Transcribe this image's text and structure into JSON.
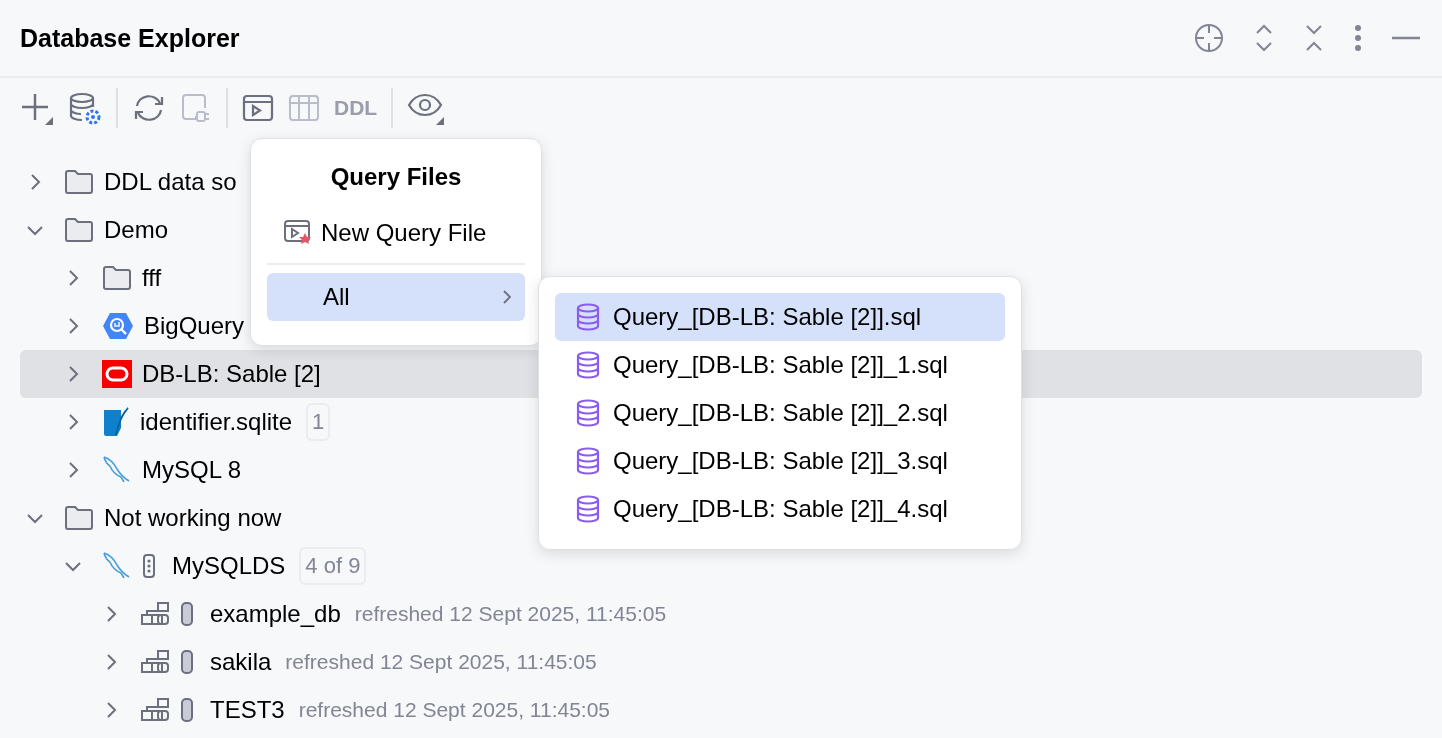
{
  "header": {
    "title": "Database Explorer"
  },
  "toolbar": [
    {
      "kind": "add",
      "disabled": false
    },
    {
      "kind": "db-settings",
      "disabled": false
    },
    {
      "kind": "sep"
    },
    {
      "kind": "refresh",
      "disabled": false
    },
    {
      "kind": "plug",
      "disabled": true
    },
    {
      "kind": "sep"
    },
    {
      "kind": "console",
      "disabled": false
    },
    {
      "kind": "table",
      "disabled": true
    },
    {
      "kind": "text",
      "label": "DDL",
      "disabled": true
    },
    {
      "kind": "sep"
    },
    {
      "kind": "eye",
      "disabled": false
    }
  ],
  "tree": [
    {
      "kind": "folder",
      "label": "DDL data so",
      "expanded": false,
      "selected": false
    },
    {
      "kind": "folder",
      "label": "Demo",
      "expanded": true,
      "selected": false,
      "children": [
        {
          "kind": "folder",
          "label": "fff",
          "expanded": false,
          "selected": false
        },
        {
          "kind": "bigquery",
          "label": "BigQuery",
          "expanded": false,
          "selected": false
        },
        {
          "kind": "oracle",
          "label": "DB-LB: Sable [2]",
          "expanded": false,
          "selected": true
        },
        {
          "kind": "sqlite",
          "label": "identifier.sqlite",
          "badge": "1",
          "expanded": false,
          "selected": false
        },
        {
          "kind": "mysql",
          "label": "MySQL 8",
          "expanded": false,
          "selected": false
        }
      ]
    },
    {
      "kind": "folder",
      "label": "Not working now",
      "expanded": true,
      "selected": false,
      "children": [
        {
          "kind": "mysql",
          "label": "MySQLDS",
          "badge": "4 of 9",
          "server": true,
          "expanded": true,
          "selected": false,
          "children": [
            {
              "kind": "schema",
              "label": "example_db",
              "detail": "refreshed 12 Sept 2025, 11:45:05",
              "expanded": false,
              "selected": false
            },
            {
              "kind": "schema",
              "label": "sakila",
              "detail": "refreshed 12 Sept 2025, 11:45:05",
              "expanded": false,
              "selected": false
            },
            {
              "kind": "schema",
              "label": "TEST3",
              "detail": "refreshed 12 Sept 2025, 11:45:05",
              "expanded": false,
              "selected": false
            }
          ]
        }
      ]
    }
  ],
  "query_menu": {
    "title": "Query Files",
    "items": [
      {
        "kind": "new",
        "label": "New Query File",
        "selected": false
      },
      {
        "kind": "submenu",
        "label": "All",
        "selected": true
      }
    ]
  },
  "all_submenu": {
    "items": [
      {
        "label": "Query_[DB-LB: Sable [2]].sql",
        "selected": true
      },
      {
        "label": "Query_[DB-LB: Sable [2]]_1.sql",
        "selected": false
      },
      {
        "label": "Query_[DB-LB: Sable [2]]_2.sql",
        "selected": false
      },
      {
        "label": "Query_[DB-LB: Sable [2]]_3.sql",
        "selected": false
      },
      {
        "label": "Query_[DB-LB: Sable [2]]_4.sql",
        "selected": false
      }
    ]
  }
}
